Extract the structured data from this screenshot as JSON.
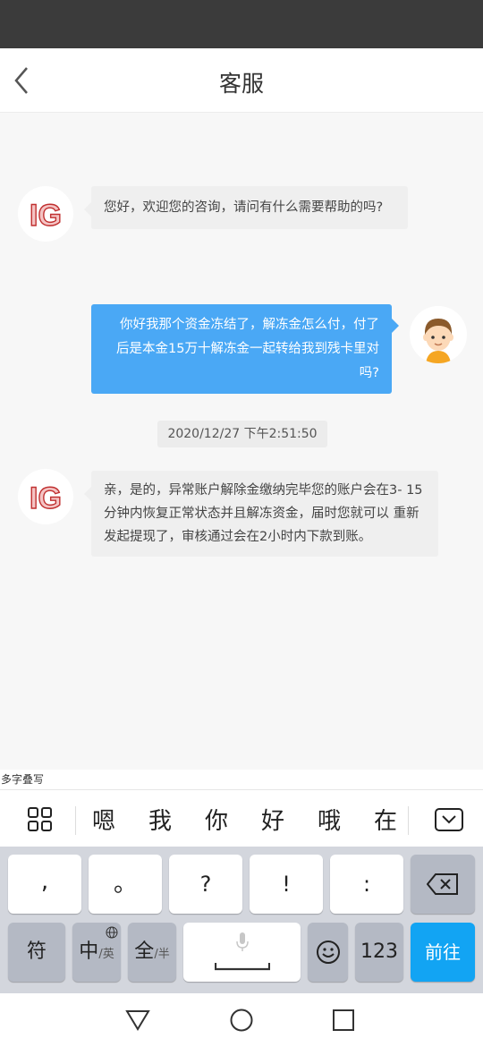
{
  "nav": {
    "title": "客服"
  },
  "chat": {
    "messages": [
      {
        "from": "agent",
        "text": "您好，欢迎您的咨询，请问有什么需要帮助的吗?",
        "avatar_logo": "IG"
      },
      {
        "from": "user",
        "lines": [
          "你好我那个资金冻结了，解冻金怎么付，付了",
          "后是本金15万十解冻金一起转给我到残卡里对",
          "吗?"
        ]
      },
      {
        "from": "agent",
        "lines": [
          "亲，是的，异常账户解除金缴纳完毕您的账户会在3-",
          "15分钟内恢复正常状态并且解冻资金，届时您就可以",
          "重新发起提现了，审核通过会在2小时内下款到账。"
        ],
        "avatar_logo": "IG"
      }
    ],
    "timestamp": "2020/12/27 下午2:51:50"
  },
  "ime": {
    "hint": "多字叠写",
    "candidates": [
      "嗯",
      "我",
      "你",
      "好",
      "哦",
      "在"
    ],
    "row1": [
      ",",
      "。",
      "?",
      "!",
      ":"
    ],
    "row2": {
      "symbol": "符",
      "zh": "中",
      "en_small": "/英",
      "full": "全",
      "half_small": "/半",
      "num": "123",
      "go": "前往"
    }
  },
  "colors": {
    "accent": "#4aa8f5",
    "go_key": "#12a4f3"
  }
}
